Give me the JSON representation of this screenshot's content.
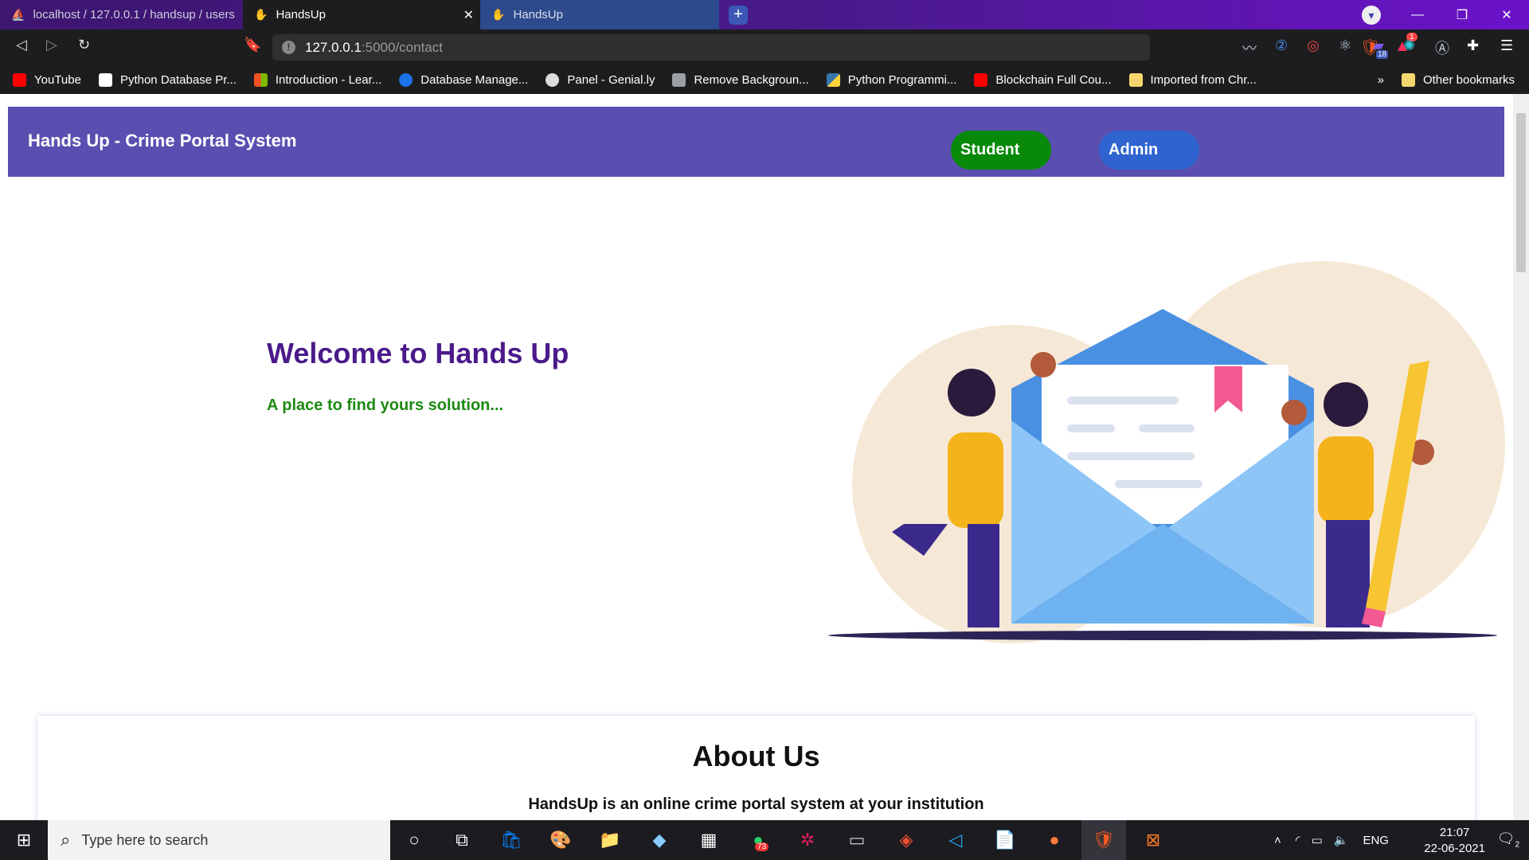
{
  "browser": {
    "tabs": [
      {
        "title": "localhost / 127.0.0.1 / handsup / users",
        "active": false
      },
      {
        "title": "HandsUp",
        "active": true
      },
      {
        "title": "HandsUp",
        "active": false
      }
    ],
    "new_tab_label": "+",
    "url_host": "127.0.0.1",
    "url_path": ":5000/contact",
    "extension_badge": "18",
    "alert_badge": "1",
    "bookmarks": [
      {
        "label": "YouTube",
        "color": "#ff0000"
      },
      {
        "label": "Python Database Pr...",
        "color": "#ffffff"
      },
      {
        "label": "Introduction - Lear...",
        "color": "#f25022"
      },
      {
        "label": "Database Manage...",
        "color": "#1a73e8"
      },
      {
        "label": "Panel - Genial.ly",
        "color": "#dddddd"
      },
      {
        "label": "Remove Backgroun...",
        "color": "#9aa0a6"
      },
      {
        "label": "Python Programmi...",
        "color": "#3776ab"
      },
      {
        "label": "Blockchain Full Cou...",
        "color": "#ff0000"
      },
      {
        "label": "Imported from Chr...",
        "color": "#f5d76e"
      }
    ],
    "overflow_label": "»",
    "other_bookmarks": "Other bookmarks"
  },
  "page": {
    "brand": "Hands Up - Crime Portal System",
    "nav": {
      "student": "Student",
      "admin": "Admin"
    },
    "hero_title": "Welcome to Hands Up",
    "hero_subtitle": "A place to find yours solution...",
    "about_title": "About Us",
    "about_text": "HandsUp is an online crime portal system at your institution",
    "colors": {
      "navbar": "#5a4fb0",
      "student": "#08890a",
      "admin": "#2f64d0",
      "title": "#4b1a8a",
      "subtitle": "#1d8a13"
    }
  },
  "taskbar": {
    "search_placeholder": "Type here to search",
    "whatsapp_badge": "73",
    "lang": "ENG",
    "time": "21:07",
    "date": "22-06-2021",
    "notif_count": "2"
  }
}
